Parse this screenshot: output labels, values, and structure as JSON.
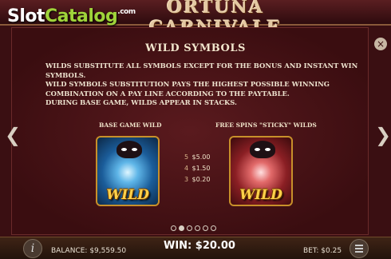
{
  "header": {
    "title": "ORTUNA CARNIVALE"
  },
  "watermark": {
    "part1": "Slot",
    "part2": "Catalog",
    "suffix": ".com"
  },
  "paytable": {
    "heading": "WILD SYMBOLS",
    "description": [
      "WILDS SUBSTITUTE ALL SYMBOLS EXCEPT FOR THE BONUS AND INSTANT WIN SYMBOLS.",
      "WILD SYMBOLS SUBSTITUTION PAYS THE HIGHEST POSSIBLE WINNING COMBINATION ON A PAY LINE ACCORDING TO THE PAYTABLE.",
      "DURING BASE GAME, WILDS APPEAR IN STACKS."
    ],
    "base_label": "BASE GAME WILD",
    "free_label": "FREE SPINS \"STICKY\" WILDS",
    "symbol_text": "WILD",
    "pays": [
      {
        "count": "5",
        "amount": "$5.00"
      },
      {
        "count": "4",
        "amount": "$1.50"
      },
      {
        "count": "3",
        "amount": "$0.20"
      }
    ],
    "pages_total": 6,
    "page_active": 2
  },
  "icons": {
    "close": "close-icon",
    "prev": "chevron-left-icon",
    "next": "chevron-right-icon",
    "info": "info-icon",
    "menu": "menu-icon"
  },
  "glyphs": {
    "close": "×",
    "prev": "❮",
    "next": "❯",
    "info": "i"
  },
  "bottom": {
    "balance_label": "BALANCE:",
    "balance": "$9,559.50",
    "win_label": "WIN:",
    "win": "$20.00",
    "bet_label": "BET:",
    "bet": "$0.25"
  },
  "colors": {
    "panel": "#3a0f12",
    "accent_gold": "#ffd14a",
    "text": "#eee3cf"
  }
}
